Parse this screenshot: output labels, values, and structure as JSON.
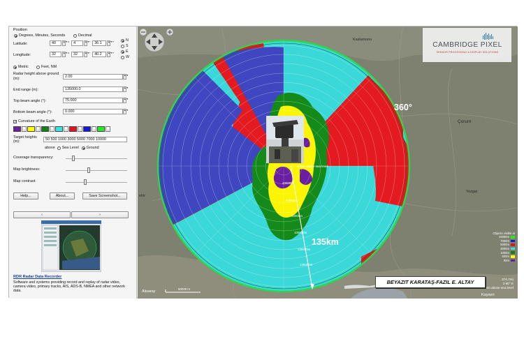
{
  "panel": {
    "position_label": "Position",
    "format_dms": "Degrees, Minutes, Seconds",
    "format_decimal": "Decimal",
    "latitude_label": "Latitude:",
    "latitude": {
      "deg": "40",
      "min": "4",
      "sec": "36.1",
      "hemi_n": "N",
      "hemi_s": "S"
    },
    "longitude_label": "Longitude:",
    "longitude": {
      "deg": "32",
      "min": "32",
      "sec": "40.2",
      "hemi_e": "E",
      "hemi_w": "W"
    },
    "units_metric": "Metric",
    "units_feet": "Feet, NM",
    "radar_height_label": "Radar height above ground (m):",
    "radar_height": "2.00",
    "end_range_label": "End range (m):",
    "end_range": "135000.0",
    "top_beam_label": "Top beam angle (°):",
    "top_beam": "75.000",
    "bottom_beam_label": "Bottom beam angle (°):",
    "bottom_beam": "0.000",
    "curvature_label": "Curvature of the Earth",
    "swatches": [
      "#6a1ea0",
      "#ffff00",
      "#13801a",
      "#39e6e6",
      "#e0141a",
      "#1418d8",
      "#22ee22"
    ],
    "target_heights_label": "Target heights (m):",
    "target_heights": "50 500 1000 3000 5000 7000 10000",
    "above_label": "above",
    "sea_level_label": "Sea Level",
    "ground_label": "Ground",
    "coverage_transparency_label": "Coverage transparency:",
    "map_brightness_label": "Map brightness:",
    "map_contrast_label": "Map contrast:",
    "sliders": {
      "transparency": 0.1,
      "brightness": 0.35,
      "contrast": 0.3
    },
    "help_button": "Help...",
    "about_button": "About...",
    "screenshot_button": "Save Screenshot...",
    "prev_arrow": "‹",
    "next_arrow": "›",
    "ad_title": "RDR Radar Data Recorder",
    "ad_text": "Software and systems providing record and replay of radar video, camera video, primary tracks, AIS, ADS-B, NMEA and other network data."
  },
  "map": {
    "logo_line1": "CAMBRIDGE PIXEL",
    "logo_line2": "SENSOR PROCESSING & DISPLAY SOLUTIONS",
    "angle_label": "360°",
    "range_label": "135km",
    "sea_level_note": "044m above sea level",
    "ring_labels": [
      "40000m",
      "60000m",
      "80000m",
      "100000m",
      "120000m",
      "130000m"
    ],
    "places": {
      "kastamonu": "Kastamonu",
      "corum": "Çorum",
      "yozgat": "Yozgat",
      "kayseri": "Kayseri",
      "aksaray": "Aksaray",
      "sehir": "ehir"
    },
    "scale_label": "50000 m",
    "caption": "BEYAZIT KARATAŞ-FAZIL E. ALTAY",
    "corner_readout": [
      "374.7m)",
      "3 80° E",
      "65m above sea level"
    ],
    "legend_title": "Objects visible at",
    "legend": [
      {
        "label": "10000m",
        "color": "#22ee22"
      },
      {
        "label": "7000m",
        "color": "#1418d8"
      },
      {
        "label": "5000m",
        "color": "#e0141a"
      },
      {
        "label": "3000m",
        "color": "#39e6e6"
      },
      {
        "label": "1000m",
        "color": "#13801a"
      },
      {
        "label": "500m",
        "color": "#ffff00"
      },
      {
        "label": "50m",
        "color": "#6a1ea0"
      }
    ]
  }
}
